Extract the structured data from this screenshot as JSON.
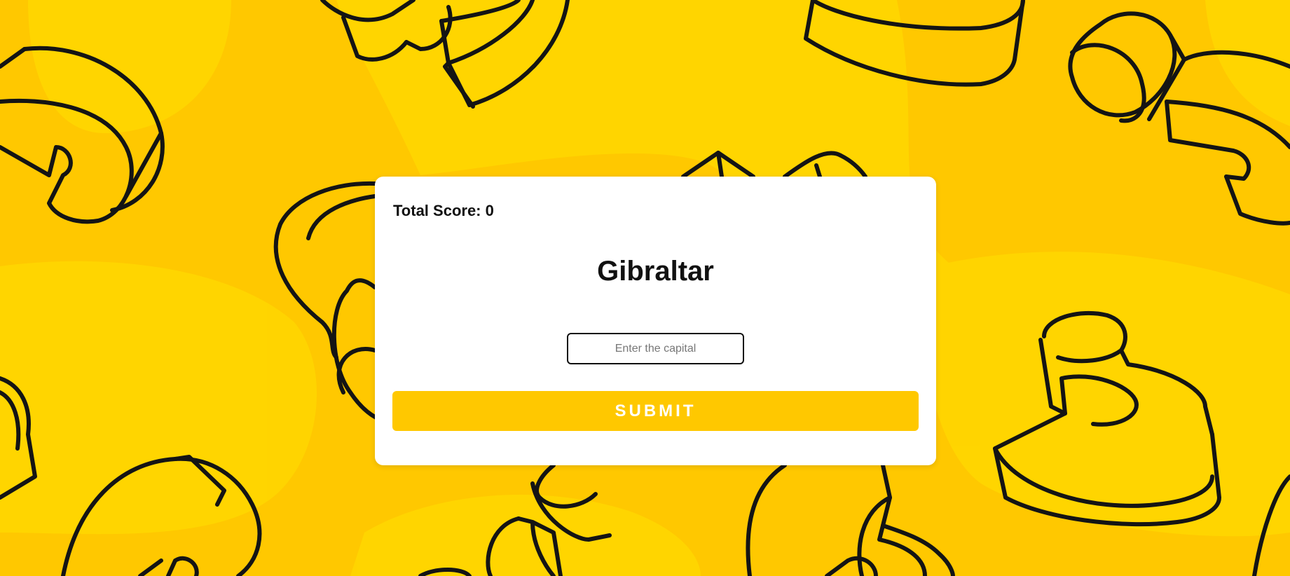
{
  "game": {
    "score_text": "Total Score: 0",
    "country": "Gibraltar",
    "answer": {
      "value": "",
      "placeholder": "Enter the capital"
    },
    "submit_label": "SUBMIT"
  },
  "theme": {
    "background": "#ffc800",
    "background_blobs": "#ffd700",
    "card": "#ffffff",
    "button": "#ffc800",
    "outline": "#141414"
  }
}
